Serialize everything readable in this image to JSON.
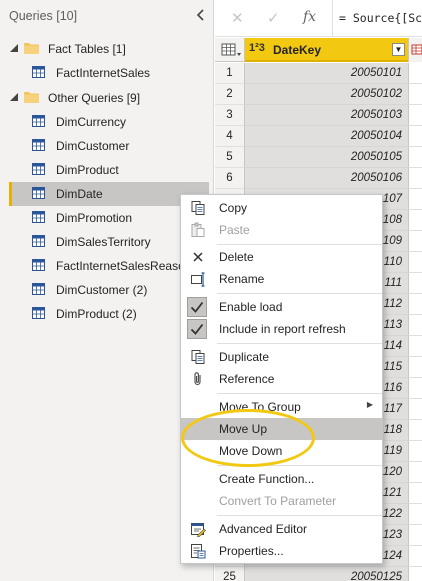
{
  "queries_pane": {
    "title": "Queries [10]",
    "collapse_icon": "chevron-left-icon",
    "groups": [
      {
        "label": "Fact Tables  [1]",
        "items": [
          "FactInternetSales"
        ]
      },
      {
        "label": "Other Queries [9]",
        "items": [
          "DimCurrency",
          "DimCustomer",
          "DimProduct",
          "DimDate",
          "DimPromotion",
          "DimSalesTerritory",
          "FactInternetSalesReason",
          "DimCustomer (2)",
          "DimProduct (2)"
        ]
      }
    ],
    "selected": "DimDate"
  },
  "formula_bar": {
    "cancel": "✕",
    "commit": "✓",
    "fx": "fx",
    "formula": "= Source{[Sch"
  },
  "grid": {
    "column_type": "1²3",
    "column_name": "DateKey",
    "rows": [
      {
        "n": "1",
        "v": "20050101"
      },
      {
        "n": "2",
        "v": "20050102"
      },
      {
        "n": "3",
        "v": "20050103"
      },
      {
        "n": "4",
        "v": "20050104"
      },
      {
        "n": "5",
        "v": "20050105"
      },
      {
        "n": "6",
        "v": "20050106"
      },
      {
        "n": "",
        "v": "107"
      },
      {
        "n": "",
        "v": "108"
      },
      {
        "n": "",
        "v": "109"
      },
      {
        "n": "",
        "v": "110"
      },
      {
        "n": "",
        "v": "111"
      },
      {
        "n": "",
        "v": "112"
      },
      {
        "n": "",
        "v": "113"
      },
      {
        "n": "",
        "v": "114"
      },
      {
        "n": "",
        "v": "115"
      },
      {
        "n": "",
        "v": "116"
      },
      {
        "n": "",
        "v": "117"
      },
      {
        "n": "",
        "v": "118"
      },
      {
        "n": "",
        "v": "119"
      },
      {
        "n": "",
        "v": "120"
      },
      {
        "n": "",
        "v": "121"
      },
      {
        "n": "",
        "v": "122"
      },
      {
        "n": "",
        "v": "123"
      },
      {
        "n": "",
        "v": "124"
      },
      {
        "n": "25",
        "v": "20050125"
      }
    ]
  },
  "context_menu": {
    "copy": "Copy",
    "paste": "Paste",
    "delete": "Delete",
    "rename": "Rename",
    "enable_load": "Enable load",
    "include_refresh": "Include in report refresh",
    "duplicate": "Duplicate",
    "reference": "Reference",
    "move_to_group": "Move To Group",
    "move_up": "Move Up",
    "move_down": "Move Down",
    "create_function": "Create Function...",
    "convert_param": "Convert To Parameter",
    "advanced_editor": "Advanced Editor",
    "properties": "Properties..."
  },
  "colors": {
    "accent": "#f2c811",
    "selection": "#c8c6c4",
    "pane_bg": "#f3f2f1"
  }
}
